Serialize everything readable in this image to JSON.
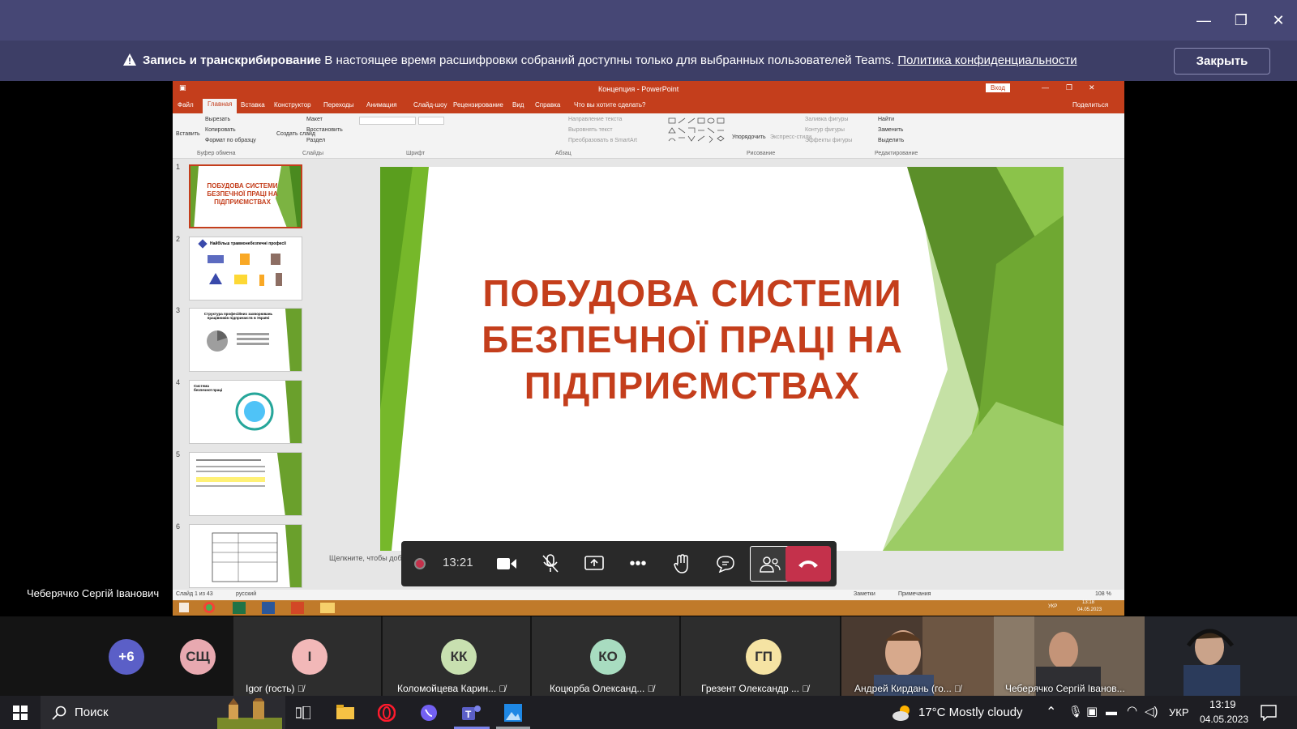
{
  "window": {
    "minimize_icon": "—",
    "restore_icon": "❐",
    "close_icon": "✕"
  },
  "banner": {
    "title": "Запись и транскрибирование",
    "message": "В настоящее время расшифровки собраний доступны только для выбранных пользователей Teams.",
    "link": "Политика конфиденциальности",
    "close_label": "Закрыть"
  },
  "powerpoint": {
    "window_title": "Концепция - PowerPoint",
    "signin_label": "Вход",
    "tabs": [
      "Файл",
      "Главная",
      "Вставка",
      "Конструктор",
      "Переходы",
      "Анимация",
      "Слайд-шоу",
      "Рецензирование",
      "Вид",
      "Справка",
      "Что вы хотите сделать?"
    ],
    "share_label": "Поделиться",
    "ribbon": {
      "cut": "Вырезать",
      "copy": "Копировать",
      "format_painter": "Формат по образцу",
      "paste": "Вставить",
      "clipboard_group": "Буфер обмена",
      "new_slide": "Создать слайд",
      "layout": "Макет",
      "reset": "Восстановить",
      "section": "Раздел",
      "slides_group": "Слайды",
      "font_group": "Шрифт",
      "paragraph_group": "Абзац",
      "text_direction": "Направление текста",
      "align_text": "Выровнять текст",
      "convert_smartart": "Преобразовать в SmartArt",
      "arrange": "Упорядочить",
      "quick_styles": "Экспресс-стили",
      "shape_fill": "Заливка фигуры",
      "shape_outline": "Контур фигуры",
      "shape_effects": "Эффекты фигуры",
      "drawing_group": "Рисование",
      "find": "Найти",
      "replace": "Заменить",
      "select": "Выделить",
      "editing_group": "Редактирование"
    },
    "thumbnails": [
      {
        "num": "1",
        "text": "ПОБУДОВА СИСТЕМИ БЕЗПЕЧНОЇ ПРАЦІ НА ПІДПРИЄМСТВАХ"
      },
      {
        "num": "2",
        "text": "Найбільш травмонебезпечні професії"
      },
      {
        "num": "3",
        "text": "Структура професійних захворювань працівників підприємств в Україні"
      },
      {
        "num": "4",
        "text": "Система безпечної праці"
      },
      {
        "num": "5",
        "text": ""
      },
      {
        "num": "6",
        "text": ""
      }
    ],
    "slide_title_lines": [
      "ПОБУДОВА СИСТЕМИ",
      "БЕЗПЕЧНОЇ ПРАЦІ НА",
      "ПІДПРИЄМСТВАХ"
    ],
    "notes_hint": "Щелкните, чтобы доб",
    "status": {
      "slide_count": "Слайд 1 из 43",
      "language": "русский",
      "notes": "Заметки",
      "comments": "Примечания",
      "zoom": "108 %"
    },
    "rdp_time": "13:18",
    "rdp_date": "04.05.2023",
    "rdp_lang": "УКР"
  },
  "meeting": {
    "timer": "13:21",
    "presenter": "Чеберячко Сергій Іванович",
    "more_count": "+6",
    "participants": [
      {
        "initials": "СЩ",
        "name": "",
        "color": "#e8a9b0"
      },
      {
        "initials": "I",
        "name": "Igor (гость)",
        "color": "#f2b8b8"
      },
      {
        "initials": "КК",
        "name": "Коломойцева Карин...",
        "color": "#c8e0b0"
      },
      {
        "initials": "КО",
        "name": "Коцюрба Олександ...",
        "color": "#a8dcc0"
      },
      {
        "initials": "ГП",
        "name": "Грезент Олександр ...",
        "color": "#f5e3a3"
      }
    ],
    "video_participants": [
      {
        "name": "Андрей Кирдань (го..."
      },
      {
        "name": "Чеберячко Сергій Іванов..."
      },
      {
        "name": ""
      }
    ]
  },
  "taskbar": {
    "search_placeholder": "Поиск",
    "weather": "17°C  Mostly cloudy",
    "lang": "УКР",
    "time": "13:19",
    "date": "04.05.2023"
  },
  "colors": {
    "teams_purple": "#464775",
    "ppt_orange": "#c43e1c",
    "leave_red": "#c4314b"
  }
}
